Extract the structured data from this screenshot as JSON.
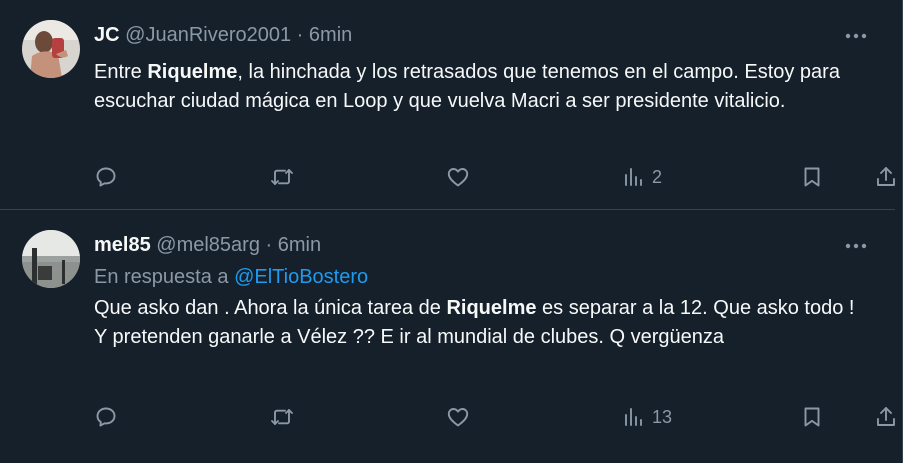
{
  "tweets": [
    {
      "name": "JC",
      "handle": "@JuanRivero2001",
      "separator": "·",
      "time": "6min",
      "text_before": "Entre ",
      "text_bold": "Riquelme",
      "text_after": ", la hinchada y los retrasados que tenemos en el campo. Estoy para escuchar ciudad mágica en Loop y que vuelva Macri a ser presidente vitalicio.",
      "views": "2"
    },
    {
      "name": "mel85",
      "handle": "@mel85arg",
      "separator": "·",
      "time": "6min",
      "reply_prefix": "En respuesta a ",
      "reply_mention": "@ElTioBostero",
      "text_before": "Que asko dan .  Ahora la única tarea de ",
      "text_bold": "Riquelme",
      "text_after": " es separar a la 12. Que asko todo ! Y pretenden ganarle a Vélez ?? E ir al mundial de clubes. Q vergüenza",
      "views": "13"
    }
  ],
  "colors": {
    "background": "#15202b",
    "text": "#f7f9f9",
    "secondary": "#8b98a5",
    "link": "#1d9bf0",
    "border": "#38444d"
  },
  "icons": [
    "more-icon",
    "reply-icon",
    "retweet-icon",
    "like-icon",
    "views-icon",
    "bookmark-icon",
    "share-icon"
  ]
}
